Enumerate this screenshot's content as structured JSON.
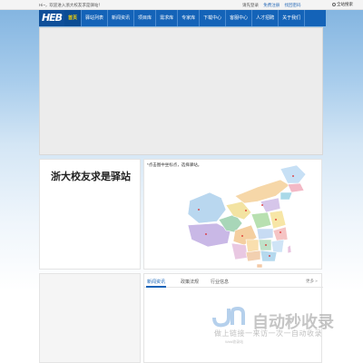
{
  "topbar": {
    "welcome": "Hi~，欢迎进入浙大校友求是驿站！",
    "login": "请先登录",
    "register": "免费注册",
    "forgot_password": "找回密码",
    "site_search": "全站搜索"
  },
  "logo_text": "HEB",
  "nav": {
    "items": [
      {
        "label": "首页",
        "active": true
      },
      {
        "label": "驿站列表",
        "active": false
      },
      {
        "label": "新闻资讯",
        "active": false
      },
      {
        "label": "项目库",
        "active": false
      },
      {
        "label": "需求库",
        "active": false
      },
      {
        "label": "专家库",
        "active": false
      },
      {
        "label": "下载中心",
        "active": false
      },
      {
        "label": "客服中心",
        "active": false
      },
      {
        "label": "人才招聘",
        "active": false
      },
      {
        "label": "关于我们",
        "active": false
      }
    ]
  },
  "station_title": "浙大校友求是驿站",
  "map": {
    "hint": "*点击图中坐标点，选择驿站。"
  },
  "news": {
    "tabs": [
      {
        "label": "新闻资讯",
        "active": true
      },
      {
        "label": "政策法规",
        "active": false
      },
      {
        "label": "行业信息",
        "active": false
      }
    ],
    "more": "更多 »"
  },
  "watermark": {
    "main": "自动秒收录",
    "sub": "做上链接一来访一次一自动收录",
    "tiny": "Web收录站"
  },
  "colors": {
    "nav_bg": "#1463b8",
    "nav_active_text": "#ffd800",
    "link_blue": "#2b6cb8"
  }
}
